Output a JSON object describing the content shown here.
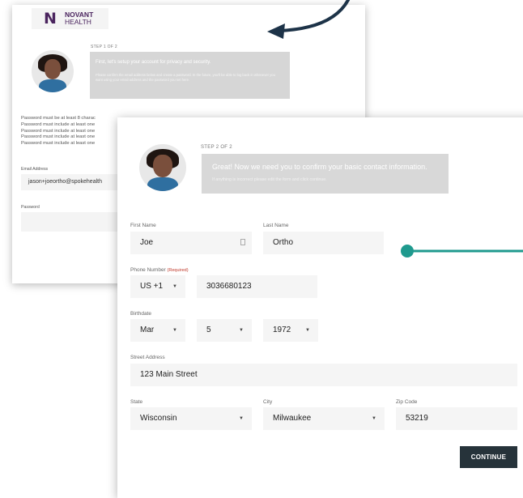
{
  "colors": {
    "brand": "#4a245e",
    "teal": "#1f9a8e",
    "navy": "#1d3348",
    "button": "#26333a"
  },
  "logo": {
    "mark": "N",
    "line1": "NOVANT",
    "line2": "HEALTH"
  },
  "step1": {
    "step_label": "STEP 1 OF 2",
    "heading": "First, let's setup your account for privacy and security.",
    "body": "Please confirm the email address below and create a password. In the future, you'll be able to log back in whenever you want using your email address and the password you set here.",
    "rules": [
      "Password must be at least 8 charac",
      "Password must include at least one",
      "Password must include at least one",
      "Password must include at least one",
      "Password must include at least one"
    ],
    "email_label": "Email Address",
    "email_value": "jason+joeortho@spokehealth",
    "password_label": "Password"
  },
  "step2": {
    "step_label": "STEP 2 OF 2",
    "heading": "Great! Now we need you to confirm your basic contact information.",
    "subtext": "If anything is incorrect please edit the form and click continue.",
    "first_name_label": "First Name",
    "first_name": "Joe",
    "last_name_label": "Last Name",
    "last_name": "Ortho",
    "phone_label": "Phone Number",
    "phone_required": "(Required)",
    "country_code": "US +1",
    "phone": "3036680123",
    "birthdate_label": "Birthdate",
    "birth_month": "Mar",
    "birth_day": "5",
    "birth_year": "1972",
    "street_label": "Street Address",
    "street": "123 Main Street",
    "state_label": "State",
    "state": "Wisconsin",
    "city_label": "City",
    "city": "Milwaukee",
    "zip_label": "Zip Code",
    "zip": "53219",
    "continue_label": "CONTINUE"
  },
  "icons": {
    "dropdown": "chevron-down-icon",
    "contact_card": "contact-card-icon"
  }
}
